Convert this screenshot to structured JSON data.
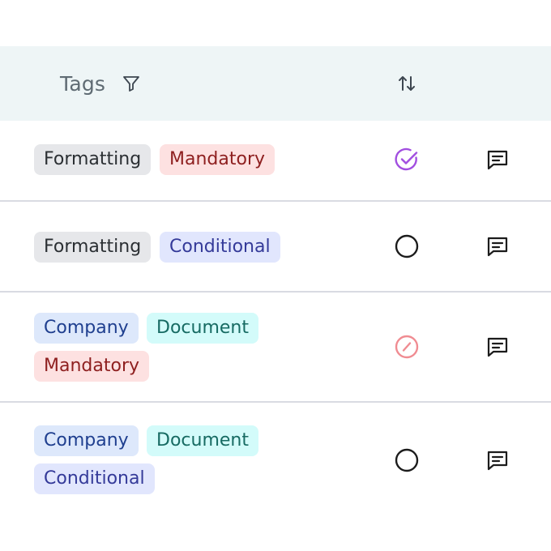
{
  "header": {
    "tags_label": "Tags",
    "filter_icon": "filter-icon",
    "sort_icon": "sort-icon"
  },
  "colors": {
    "header_bg": "#eef5f6",
    "status_done": "#a24fe0",
    "status_blocked": "#f08c92",
    "status_open": "#1c1c1c"
  },
  "rows": [
    {
      "tags": [
        "Formatting",
        "Mandatory"
      ],
      "status": "check-circle-icon",
      "action": "comment-icon"
    },
    {
      "tags": [
        "Formatting",
        "Conditional"
      ],
      "status": "empty-circle-icon",
      "action": "comment-icon"
    },
    {
      "tags": [
        "Company",
        "Document",
        "Mandatory"
      ],
      "status": "blocked-circle-icon",
      "action": "comment-icon"
    },
    {
      "tags": [
        "Company",
        "Document",
        "Conditional"
      ],
      "status": "empty-circle-icon",
      "action": "comment-icon"
    }
  ]
}
